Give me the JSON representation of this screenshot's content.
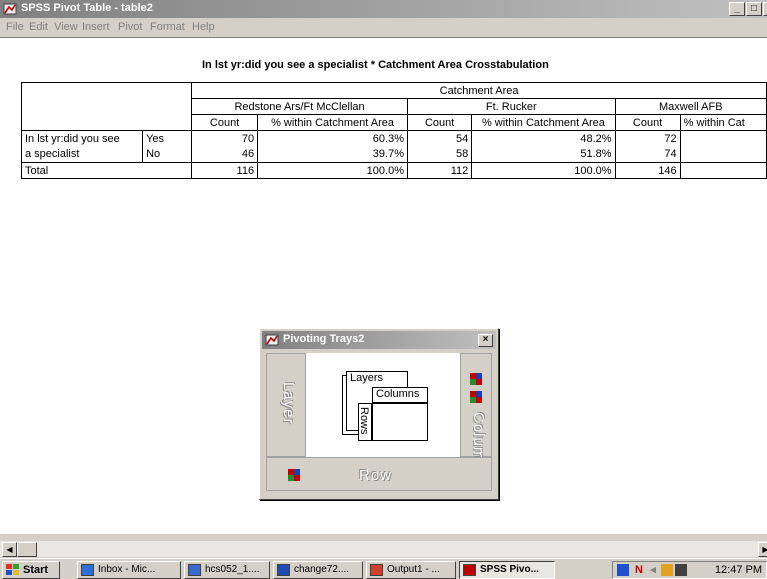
{
  "window": {
    "title": "SPSS Pivot Table - table2",
    "minimize_glyph": "_",
    "maximize_glyph": "□",
    "close_glyph": "x"
  },
  "menu": [
    "File",
    "Edit",
    "View",
    "Insert",
    "Pivot",
    "Format",
    "Help"
  ],
  "table": {
    "title": "In lst yr:did you see a specialist * Catchment Area Crosstabulation",
    "column_dimension": "Catchment Area",
    "areas": [
      "Redstone Ars/Ft McClellan",
      "Ft. Rucker",
      "Maxwell AFB"
    ],
    "stat_headers": {
      "count": "Count",
      "percent": "% within Catchment Area",
      "percent_truncated": "% within Cat"
    },
    "row_dimension_line1": "In lst yr:did you see",
    "row_dimension_line2": "a specialist",
    "rows": [
      {
        "label": "Yes",
        "values": [
          "70",
          "60.3%",
          "54",
          "48.2%",
          "72"
        ]
      },
      {
        "label": "No",
        "values": [
          "46",
          "39.7%",
          "58",
          "51.8%",
          "74"
        ]
      }
    ],
    "total": {
      "label": "Total",
      "values": [
        "116",
        "100.0%",
        "112",
        "100.0%",
        "146"
      ]
    }
  },
  "trays": {
    "title": "Pivoting Trays2",
    "close_glyph": "×",
    "layer_label": "Layer",
    "column_label": "Column",
    "row_label": "Row",
    "diagram_layers": "Layers",
    "diagram_columns": "Columns",
    "diagram_rows": "Rows"
  },
  "scrollbar": {
    "left_arrow": "◀",
    "right_arrow": "▶"
  },
  "taskbar": {
    "start": "Start",
    "tasks": [
      "Inbox - Mic...",
      "hcs052_1....",
      "change72....",
      "Output1 - ...",
      "SPSS Pivo..."
    ],
    "clock": "12:47 PM",
    "tray_icons": [
      "N"
    ]
  },
  "colors": {
    "accent_red": "#c00000",
    "icon_blue": "#1c3ea8",
    "icon_green": "#2c8a2c"
  }
}
